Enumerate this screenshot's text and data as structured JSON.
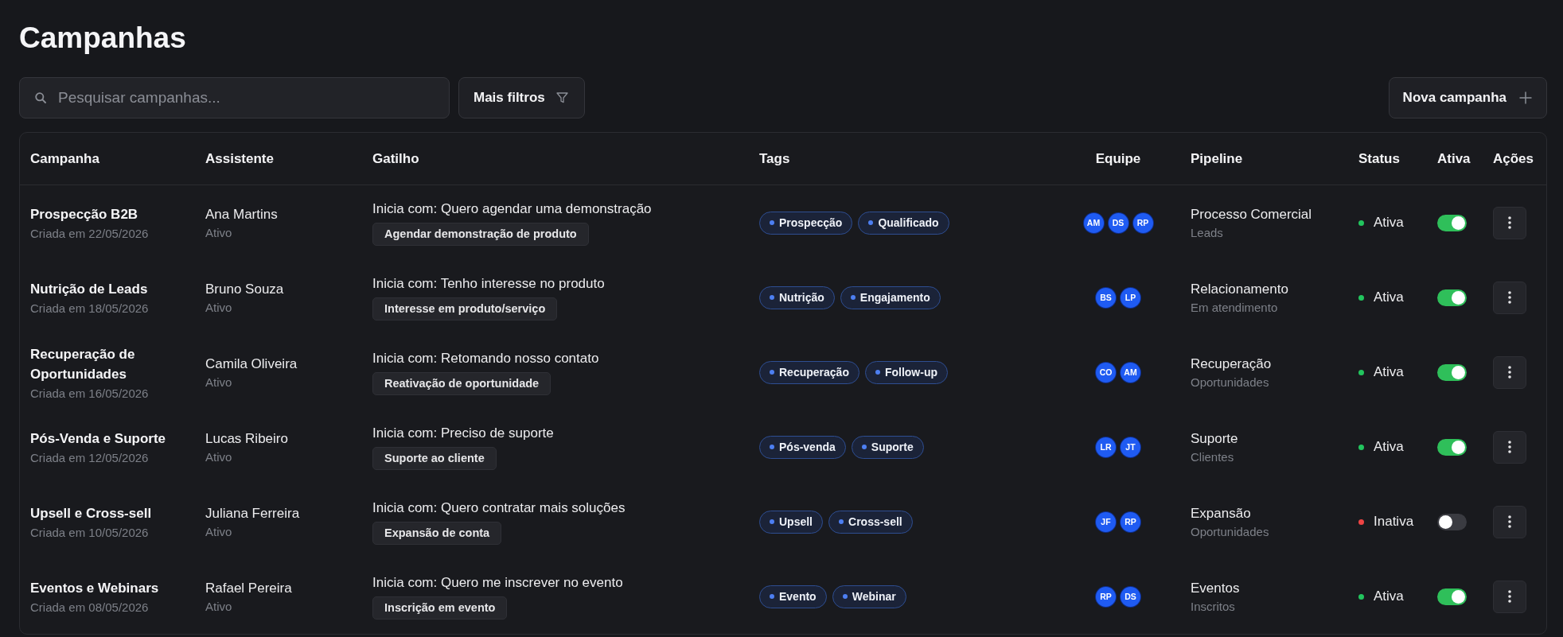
{
  "page": {
    "title": "Campanhas"
  },
  "toolbar": {
    "search": {
      "placeholder": "Pesquisar campanhas..."
    },
    "filter_button": "Mais filtros",
    "new_button": "Nova campanha"
  },
  "table": {
    "columns": [
      "Campanha",
      "Assistente",
      "Gatilho",
      "Tags",
      "Equipe",
      "Pipeline",
      "Status",
      "Ativa",
      "Ações"
    ],
    "rows": [
      {
        "campaign": "Prospecção B2B",
        "created": "Criada em 22/05/2026",
        "assistant": "Ana Martins",
        "assistant_status": "Ativo",
        "trigger": "Inicia com: Quero agendar uma demonstração",
        "trigger_label": "Agendar demonstração de produto",
        "tags": [
          "Prospecção",
          "Qualificado"
        ],
        "team": [
          "AM",
          "DS",
          "RP"
        ],
        "pipeline": "Processo Comercial",
        "stage": "Leads",
        "status": {
          "label": "Ativa",
          "color": "#22c55e"
        },
        "active": true
      },
      {
        "campaign": "Nutrição de Leads",
        "created": "Criada em 18/05/2026",
        "assistant": "Bruno Souza",
        "assistant_status": "Ativo",
        "trigger": "Inicia com: Tenho interesse no produto",
        "trigger_label": "Interesse em produto/serviço",
        "tags": [
          "Nutrição",
          "Engajamento"
        ],
        "team": [
          "BS",
          "LP"
        ],
        "pipeline": "Relacionamento",
        "stage": "Em atendimento",
        "status": {
          "label": "Ativa",
          "color": "#22c55e"
        },
        "active": true
      },
      {
        "campaign": "Recuperação de Oportunidades",
        "created": "Criada em 16/05/2026",
        "assistant": "Camila Oliveira",
        "assistant_status": "Ativo",
        "trigger": "Inicia com: Retomando nosso contato",
        "trigger_label": "Reativação de oportunidade",
        "tags": [
          "Recuperação",
          "Follow-up"
        ],
        "team": [
          "CO",
          "AM"
        ],
        "pipeline": "Recuperação",
        "stage": "Oportunidades",
        "status": {
          "label": "Ativa",
          "color": "#22c55e"
        },
        "active": true
      },
      {
        "campaign": "Pós-Venda e Suporte",
        "created": "Criada em 12/05/2026",
        "assistant": "Lucas Ribeiro",
        "assistant_status": "Ativo",
        "trigger": "Inicia com: Preciso de suporte",
        "trigger_label": "Suporte ao cliente",
        "tags": [
          "Pós-venda",
          "Suporte"
        ],
        "team": [
          "LR",
          "JT"
        ],
        "pipeline": "Suporte",
        "stage": "Clientes",
        "status": {
          "label": "Ativa",
          "color": "#22c55e"
        },
        "active": true
      },
      {
        "campaign": "Upsell e Cross-sell",
        "created": "Criada em 10/05/2026",
        "assistant": "Juliana Ferreira",
        "assistant_status": "Ativo",
        "trigger": "Inicia com: Quero contratar mais soluções",
        "trigger_label": "Expansão de conta",
        "tags": [
          "Upsell",
          "Cross-sell"
        ],
        "team": [
          "JF",
          "RP"
        ],
        "pipeline": "Expansão",
        "stage": "Oportunidades",
        "status": {
          "label": "Inativa",
          "color": "#ef4444"
        },
        "active": false
      },
      {
        "campaign": "Eventos e Webinars",
        "created": "Criada em 08/05/2026",
        "assistant": "Rafael Pereira",
        "assistant_status": "Ativo",
        "trigger": "Inicia com: Quero me inscrever no evento",
        "trigger_label": "Inscrição em evento",
        "tags": [
          "Evento",
          "Webinar"
        ],
        "team": [
          "RP",
          "DS"
        ],
        "pipeline": "Eventos",
        "stage": "Inscritos",
        "status": {
          "label": "Ativa",
          "color": "#22c55e"
        },
        "active": true
      }
    ]
  }
}
